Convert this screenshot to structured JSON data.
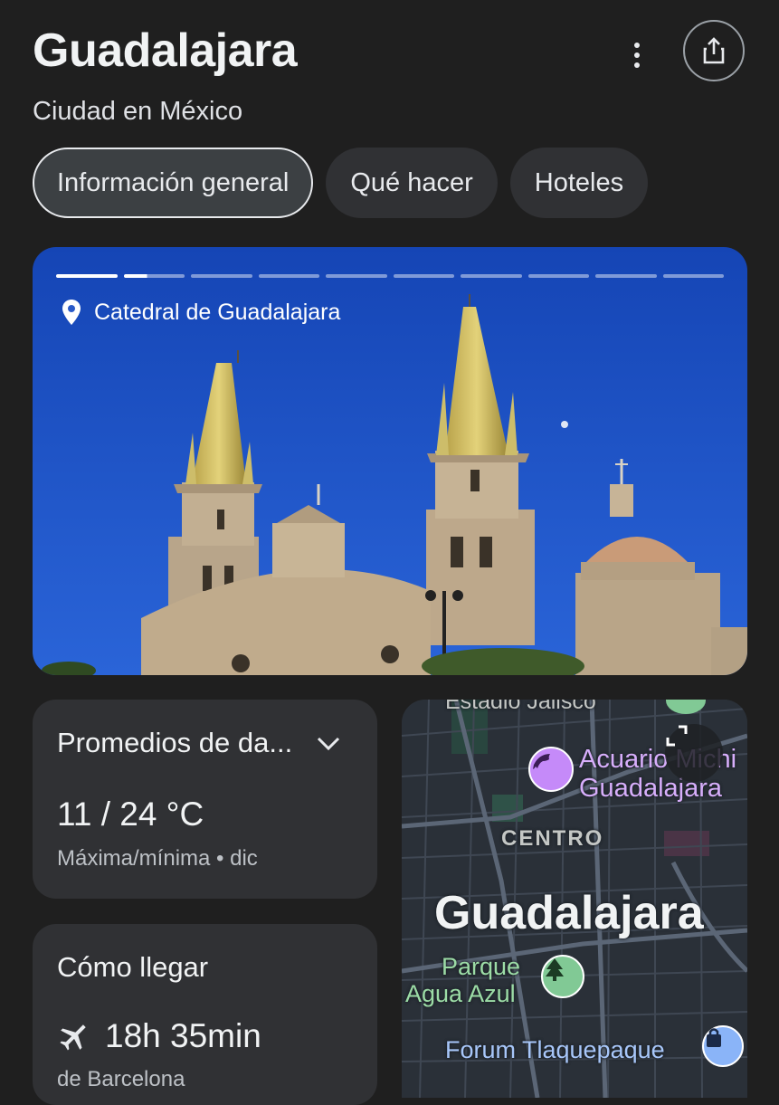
{
  "header": {
    "title": "Guadalajara",
    "subtitle": "Ciudad en México",
    "more_icon": "more-vert-icon",
    "share_icon": "share-icon"
  },
  "tabs": [
    {
      "label": "Información general",
      "active": true
    },
    {
      "label": "Qué hacer",
      "active": false
    },
    {
      "label": "Hoteles",
      "active": false
    }
  ],
  "hero": {
    "caption": "Catedral de Guadalajara",
    "pin_icon": "location-pin-icon",
    "slides_total": 10,
    "current_slide": 2
  },
  "weather": {
    "title": "Promedios de da...",
    "temp": "11 / 24 °C",
    "sub": "Máxima/mínima • dic",
    "chevron_icon": "chevron-down-icon"
  },
  "route": {
    "title": "Cómo llegar",
    "duration": "18h 35min",
    "from": "de Barcelona",
    "plane_icon": "airplane-icon"
  },
  "map": {
    "stadium": "Estadio Jalisco",
    "aquarium_line1": "Acuario Michi",
    "aquarium_line2": "Guadalajara",
    "district": "CENTRO",
    "city": "Guadalajara",
    "park_line1": "Parque",
    "park_line2": "Agua Azul",
    "mall": "Forum Tlaquepaque",
    "expand_icon": "expand-icon"
  },
  "colors": {
    "background": "#1f1f1f",
    "card": "#303134",
    "sky": "#1d4fc4",
    "map_bg": "#2b3138",
    "poi_purple": "#c58af9",
    "poi_green": "#81c995",
    "poi_blue": "#8ab4f8"
  }
}
